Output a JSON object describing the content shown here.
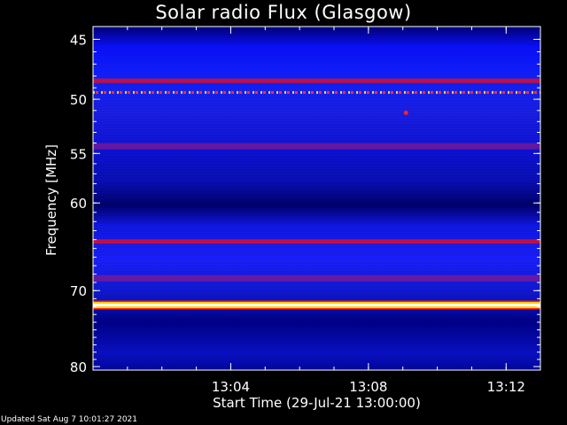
{
  "chart_data": {
    "type": "heatmap",
    "title": "Solar radio Flux (Glasgow)",
    "ylabel": "Frequency [MHz]",
    "xlabel": "Start Time (29-Jul-21 13:00:00)",
    "y_ticks": [
      45,
      50,
      55,
      60,
      70,
      80
    ],
    "x_ticks": [
      "13:04",
      "13:08",
      "13:12"
    ],
    "y_axis_scale": "log",
    "y_range": [
      80,
      45
    ],
    "x_range_minutes": [
      13.0,
      13.2166
    ],
    "colormap": [
      "#000000",
      "#000070",
      "#0000ff",
      "#8000a0",
      "#ff0000",
      "#ffff00",
      "#ffffff"
    ],
    "emission_bands_mhz": [
      {
        "freq": 48.4,
        "level": "red"
      },
      {
        "freq": 49.4,
        "level": "red-dashed"
      },
      {
        "freq": 54.3,
        "level": "purple"
      },
      {
        "freq": 64.2,
        "level": "red"
      },
      {
        "freq": 68.5,
        "level": "purple"
      },
      {
        "freq": 71.8,
        "level": "white-hot"
      }
    ],
    "grid": false
  },
  "footer": {
    "updated": "Updated Sat Aug  7 10:01:27 2021"
  }
}
